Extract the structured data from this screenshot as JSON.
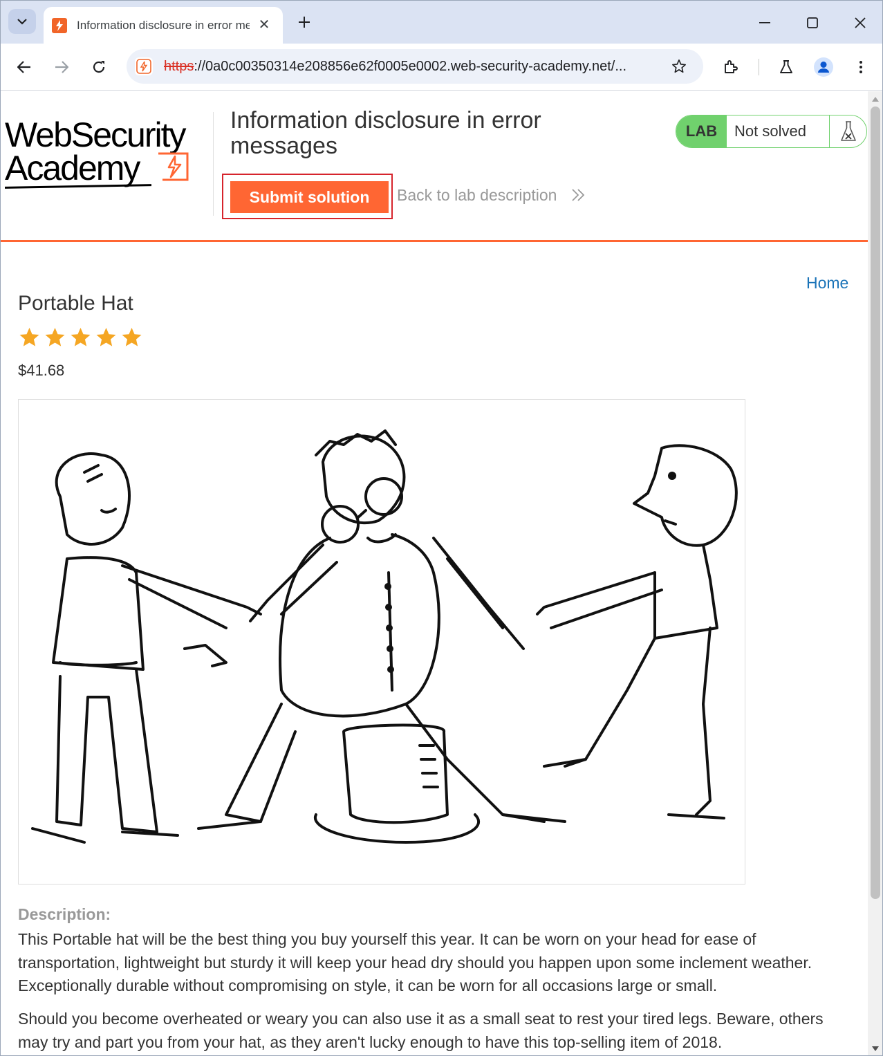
{
  "browser": {
    "tab_title": "Information disclosure in error messages",
    "url_scheme": "https",
    "url_rest": "://0a0c00350314e208856e62f0005e0002.web-security-academy.net/...",
    "new_tab_label": "+",
    "close_tab_label": "✕"
  },
  "lab_header": {
    "logo_line1": "WebSecurity",
    "logo_line2": "Academy",
    "title": "Information disclosure in error messages",
    "submit_label": "Submit solution",
    "back_label": "Back to lab description",
    "badge_lab": "LAB",
    "badge_status": "Not solved"
  },
  "nav": {
    "home_label": "Home"
  },
  "product": {
    "name": "Portable Hat",
    "rating": 5,
    "rating_max": 5,
    "price": "$41.68",
    "description_label": "Description:",
    "description_p1": "This Portable hat will be the best thing you buy yourself this year. It can be worn on your head for ease of transportation, lightweight but sturdy it will keep your head dry should you happen upon some inclement weather. Exceptionally durable without compromising on style, it can be worn for all occasions large or small.",
    "description_p2": "Should you become overheated or weary you can also use it as a small seat to rest your tired legs. Beware, others may try and part you from your hat, as they aren't lucky enough to have this top-selling item of 2018."
  },
  "colors": {
    "accent": "#ff6633",
    "lab_green": "#70d16d",
    "link_blue": "#1a73b8",
    "star": "#f5a623",
    "highlight_red": "#d6242c"
  }
}
